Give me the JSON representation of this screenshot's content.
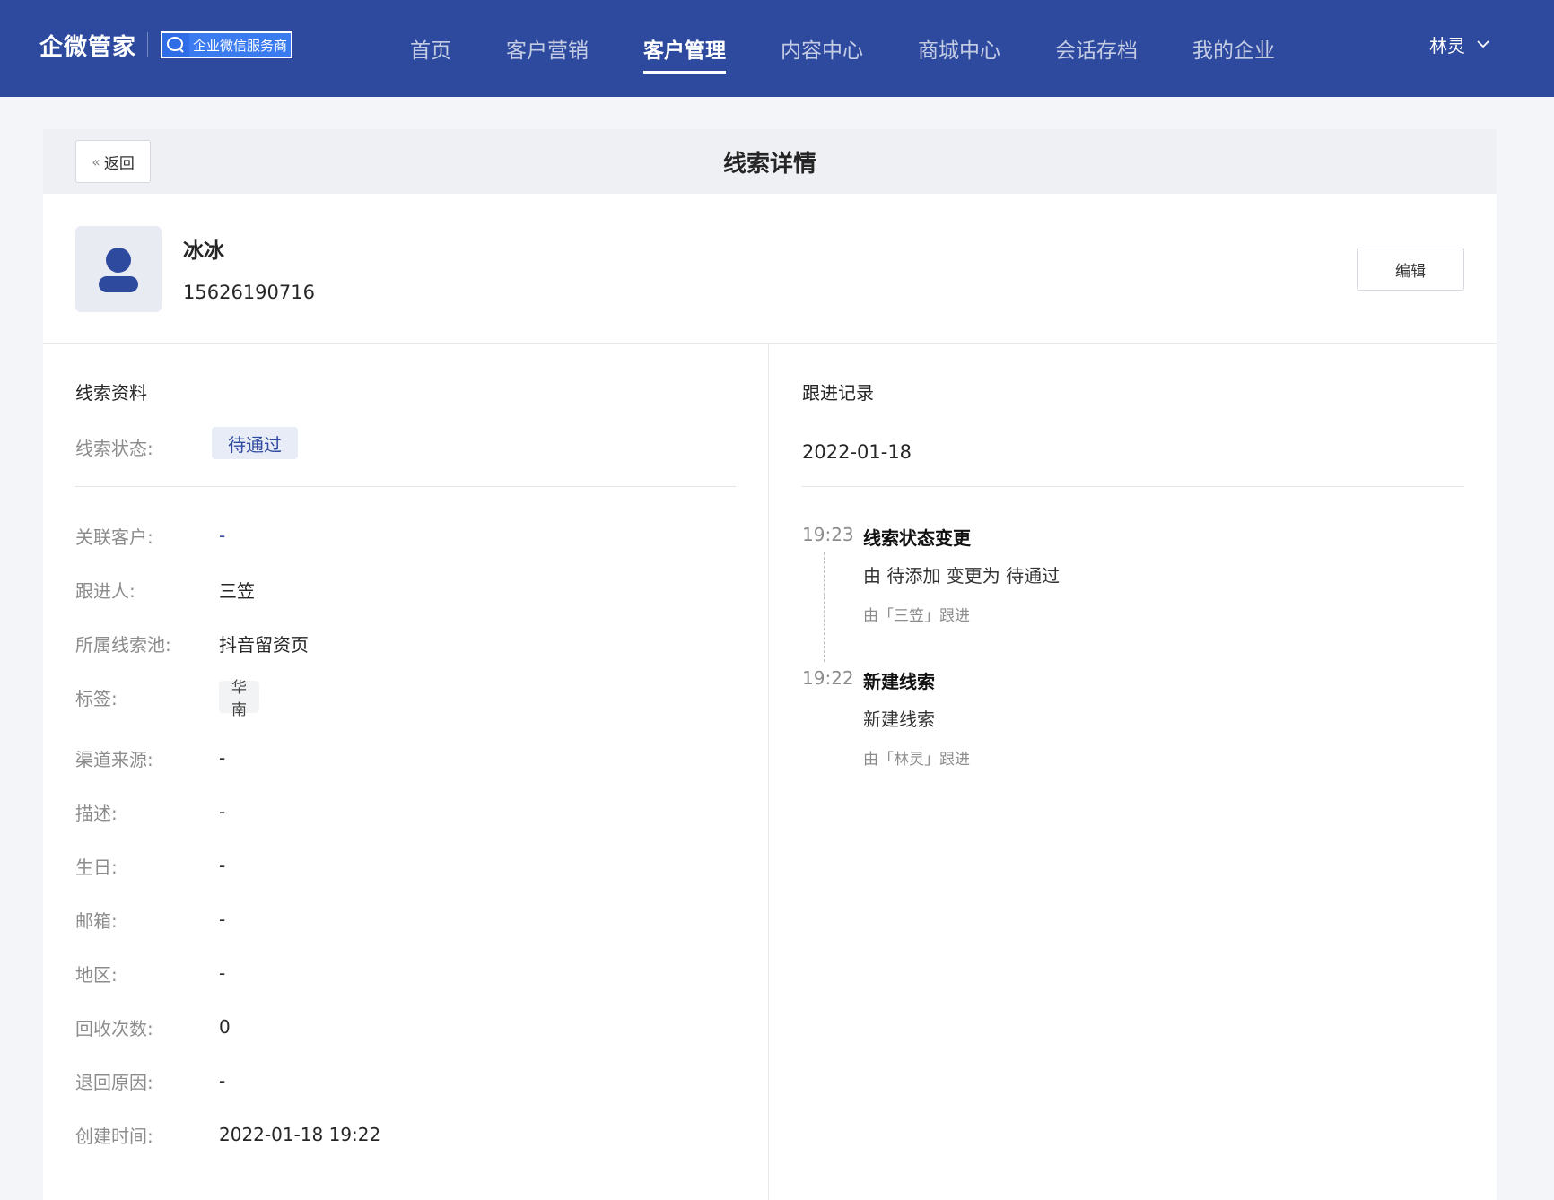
{
  "brand": {
    "name": "企微管家",
    "badge": "企业微信服务商"
  },
  "nav": {
    "items": [
      {
        "label": "首页"
      },
      {
        "label": "客户营销"
      },
      {
        "label": "客户管理"
      },
      {
        "label": "内容中心"
      },
      {
        "label": "商城中心"
      },
      {
        "label": "会话存档"
      },
      {
        "label": "我的企业"
      }
    ],
    "active_index": 2
  },
  "user": {
    "name": "林灵"
  },
  "page": {
    "back_label": "返回",
    "title": "线索详情"
  },
  "lead": {
    "name": "冰冰",
    "phone": "15626190716",
    "edit_label": "编辑"
  },
  "info": {
    "section_title": "线索资料",
    "status_label": "线索状态:",
    "status_value": "待通过",
    "fields": [
      {
        "label": "关联客户:",
        "value": "-"
      },
      {
        "label": "跟进人:",
        "value": "三笠"
      },
      {
        "label": "所属线索池:",
        "value": "抖音留资页"
      },
      {
        "label": "标签:",
        "value": "华南"
      },
      {
        "label": "渠道来源:",
        "value": "-"
      },
      {
        "label": "描述:",
        "value": "-"
      },
      {
        "label": "生日:",
        "value": "-"
      },
      {
        "label": "邮箱:",
        "value": "-"
      },
      {
        "label": "地区:",
        "value": "-"
      },
      {
        "label": "回收次数:",
        "value": "0"
      },
      {
        "label": "退回原因:",
        "value": "-"
      },
      {
        "label": "创建时间:",
        "value": "2022-01-18 19:22"
      }
    ]
  },
  "followup": {
    "section_title": "跟进记录",
    "date": "2022-01-18",
    "records": [
      {
        "time": "19:23",
        "title": "线索状态变更",
        "desc": "由 待添加 变更为 待通过",
        "by": "由「三笠」跟进"
      },
      {
        "time": "19:22",
        "title": "新建线索",
        "desc": "新建线索",
        "by": "由「林灵」跟进"
      }
    ]
  },
  "colors": {
    "primary": "#2e4a9e",
    "header_bg": "#eef0f4",
    "page_bg": "#f4f5f9"
  }
}
